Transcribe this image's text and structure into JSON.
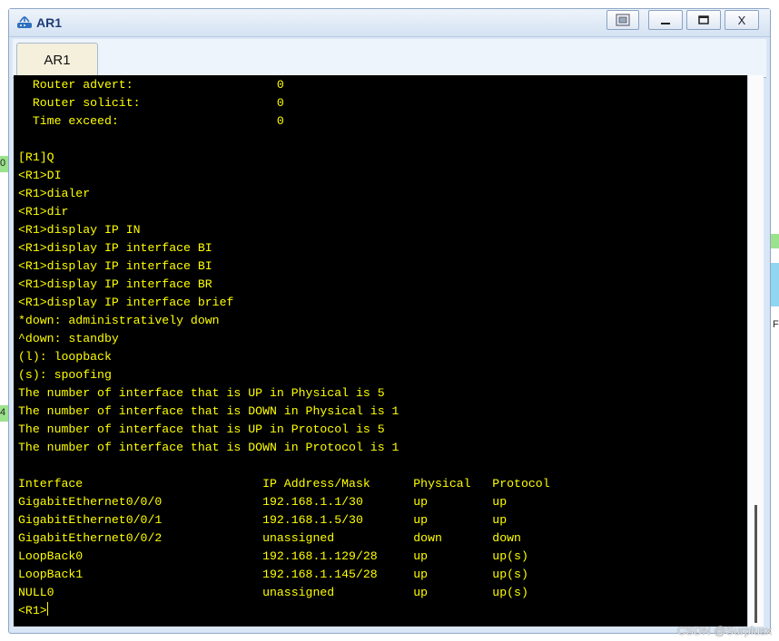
{
  "window": {
    "title": "AR1",
    "icon": "router-icon",
    "controls": [
      "restore-icon",
      "minimize-icon",
      "maximize-icon",
      "close-icon"
    ],
    "close_glyph": "X"
  },
  "tabs": [
    {
      "label": "AR1"
    }
  ],
  "terminal": {
    "text_color": "#ffff00",
    "background": "#000000",
    "prompt": "<R1>",
    "lines": [
      "  Router advert:                    0",
      "  Router solicit:                   0",
      "  Time exceed:                      0",
      "",
      "[R1]Q",
      "<R1>DI",
      "<R1>dialer",
      "<R1>dir",
      "<R1>display IP IN",
      "<R1>display IP interface BI",
      "<R1>display IP interface BI",
      "<R1>display IP interface BR",
      "<R1>display IP interface brief",
      "*down: administratively down",
      "^down: standby",
      "(l): loopback",
      "(s): spoofing",
      "The number of interface that is UP in Physical is 5",
      "The number of interface that is DOWN in Physical is 1",
      "The number of interface that is UP in Protocol is 5",
      "The number of interface that is DOWN in Protocol is 1",
      "",
      "Interface                         IP Address/Mask      Physical   Protocol",
      "GigabitEthernet0/0/0              192.168.1.1/30       up         up",
      "GigabitEthernet0/0/1              192.168.1.5/30       up         up",
      "GigabitEthernet0/0/2              unassigned           down       down",
      "LoopBack0                         192.168.1.129/28     up         up(s)",
      "LoopBack1                         192.168.1.145/28     up         up(s)",
      "NULL0                             unassigned           up         up(s)"
    ]
  },
  "background_labels": {
    "left_top": "0",
    "left_bottom": "4",
    "right": "F"
  },
  "watermark": "CSDN @Surplusx"
}
